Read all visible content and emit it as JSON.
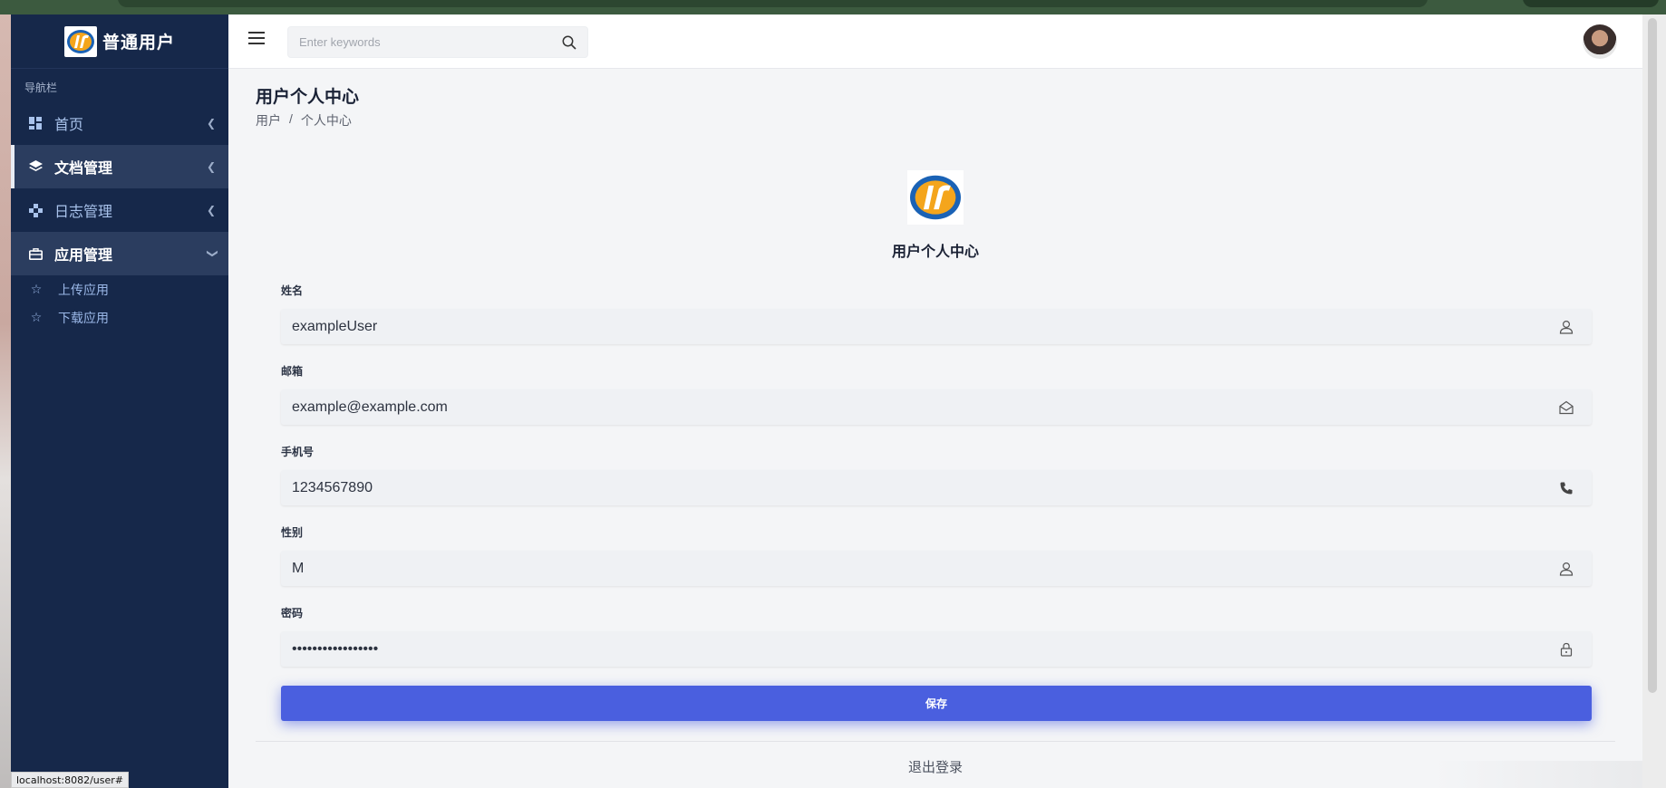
{
  "sidebar": {
    "brand_title": "普通用户",
    "nav_caption": "导航栏",
    "items": [
      {
        "label": "首页",
        "icon": "dashboard-icon"
      },
      {
        "label": "文档管理",
        "icon": "layers-icon"
      },
      {
        "label": "日志管理",
        "icon": "puzzle-icon"
      },
      {
        "label": "应用管理",
        "icon": "briefcase-icon"
      }
    ],
    "sub_items": [
      {
        "label": "上传应用",
        "icon": "star-icon"
      },
      {
        "label": "下载应用",
        "icon": "star-icon"
      }
    ]
  },
  "status_url": "localhost:8082/user#",
  "topbar": {
    "search_placeholder": "Enter keywords"
  },
  "page": {
    "title": "用户个人中心",
    "breadcrumb": [
      "用户",
      "/",
      "个人中心"
    ],
    "profile_title": "用户个人中心"
  },
  "form": {
    "name_label": "姓名",
    "name_value": "exampleUser",
    "email_label": "邮箱",
    "email_value": "example@example.com",
    "phone_label": "手机号",
    "phone_value": "1234567890",
    "gender_label": "性别",
    "gender_value": "M",
    "password_label": "密码",
    "password_value": "examplePassword12",
    "save_label": "保存"
  },
  "logout_label": "退出登录",
  "colors": {
    "sidebar_bg": "#16284a",
    "accent": "#4a5fdf",
    "active_item_bg": "#2b3d5f"
  }
}
